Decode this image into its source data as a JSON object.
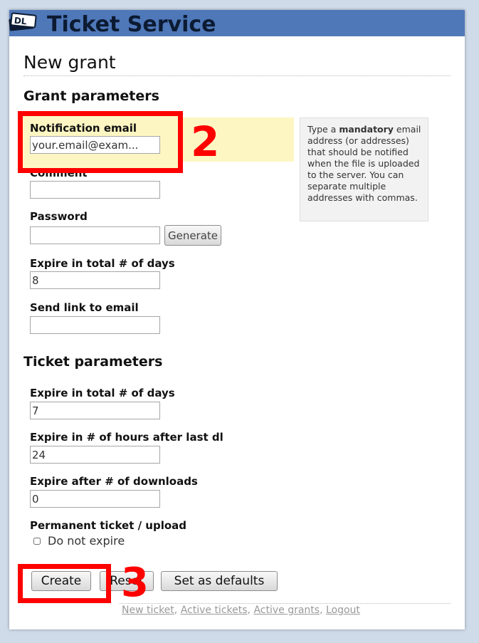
{
  "header": {
    "title": "Ticket Service",
    "logo_icon": "ticket-logo-icon",
    "background_color": "#4f78b9"
  },
  "page": {
    "title": "New grant"
  },
  "grant": {
    "section_title": "Grant parameters",
    "notification_email": {
      "label": "Notification email",
      "placeholder": "your.email@exam..."
    },
    "comment": {
      "label": "Comment",
      "value": ""
    },
    "password": {
      "label": "Password",
      "value": "",
      "generate_label": "Generate"
    },
    "expire_days": {
      "label": "Expire in total # of days",
      "value": "8"
    },
    "send_link": {
      "label": "Send link to email",
      "value": ""
    }
  },
  "help": {
    "before": "Type a ",
    "strong": "mandatory",
    "after": " email address (or addresses) that should be notified when the file is uploaded to the server. You can separate multiple addresses with commas."
  },
  "ticket": {
    "section_title": "Ticket parameters",
    "expire_days": {
      "label": "Expire in total # of days",
      "value": "7"
    },
    "expire_hours": {
      "label": "Expire in # of hours after last dl",
      "value": "24"
    },
    "expire_downloads": {
      "label": "Expire after # of downloads",
      "value": "0"
    },
    "permanent": {
      "label": "Permanent ticket / upload",
      "checkbox_label": "Do not expire",
      "checked": false
    }
  },
  "actions": {
    "create": "Create",
    "reset": "Reset",
    "set_defaults": "Set as defaults"
  },
  "footer": {
    "links": [
      "New ticket",
      "Active tickets",
      "Active grants",
      "Logout"
    ],
    "separator": ", "
  },
  "annotations": {
    "step_2": "2",
    "step_3": "3",
    "color": "#ff0000"
  }
}
